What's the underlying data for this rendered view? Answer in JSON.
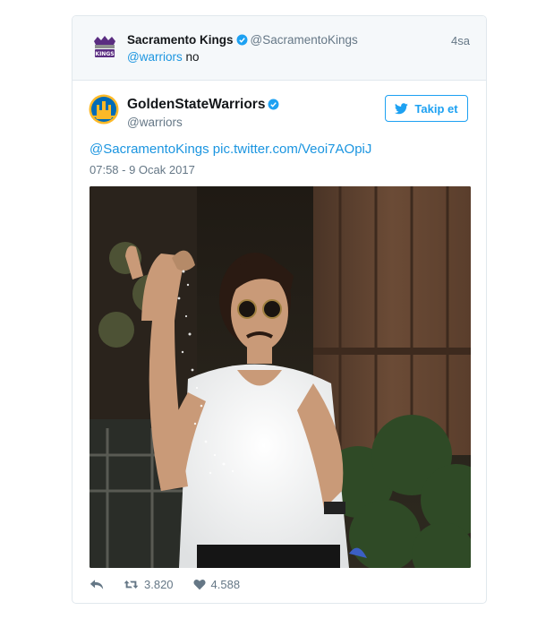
{
  "reply_context": {
    "name": "Sacramento Kings",
    "handle": "@SacramentoKings",
    "time": "4sa",
    "text_mention": "@warriors",
    "text_rest": " no"
  },
  "tweet": {
    "name": "GoldenStateWarriors",
    "handle": "@warriors",
    "follow_label": "Takip et",
    "text_mention": "@SacramentoKings",
    "text_link": "pic.twitter.com/Veoi7AOpiJ",
    "date": "07:58 - 9 Ocak 2017"
  },
  "actions": {
    "retweets": "3.820",
    "likes": "4.588"
  },
  "colors": {
    "link": "#1b95e0",
    "twitter_blue": "#1da1f2",
    "muted": "#657786",
    "header_bg": "#f5f8fa"
  },
  "icons": [
    "kings-logo",
    "verified-badge-icon",
    "warriors-logo",
    "twitter-bird-icon",
    "reply-icon",
    "retweet-icon",
    "heart-icon"
  ]
}
